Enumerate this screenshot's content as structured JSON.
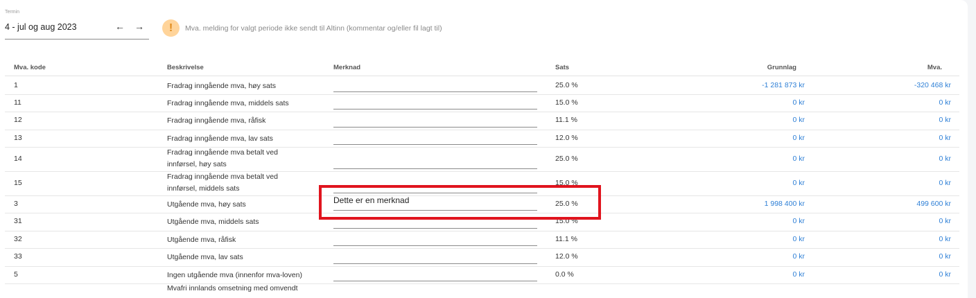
{
  "period": {
    "label": "Termin",
    "value": "4 - jul og aug 2023",
    "prev_icon": "arrow-left-icon",
    "next_icon": "arrow-right-icon"
  },
  "warning": {
    "icon": "warning-icon",
    "text": "Mva. melding for valgt periode ikke sendt til Altinn (kommentar og/eller fil lagt til)"
  },
  "table": {
    "headers": {
      "code": "Mva. kode",
      "desc": "Beskrivelse",
      "remark": "Merknad",
      "rate": "Sats",
      "base": "Grunnlag",
      "vat": "Mva."
    },
    "rows": [
      {
        "code": "1",
        "desc": [
          "Fradrag inngående mva, høy sats"
        ],
        "remark": "",
        "rate": "25.0 %",
        "base": "-1 281 873 kr",
        "vat": "-320 468 kr"
      },
      {
        "code": "11",
        "desc": [
          "Fradrag inngående mva, middels sats"
        ],
        "remark": "",
        "rate": "15.0 %",
        "base": "0 kr",
        "vat": "0 kr"
      },
      {
        "code": "12",
        "desc": [
          "Fradrag inngående mva, råfisk"
        ],
        "remark": "",
        "rate": "11.1 %",
        "base": "0 kr",
        "vat": "0 kr"
      },
      {
        "code": "13",
        "desc": [
          "Fradrag inngående mva, lav sats"
        ],
        "remark": "",
        "rate": "12.0 %",
        "base": "0 kr",
        "vat": "0 kr"
      },
      {
        "code": "14",
        "desc": [
          "Fradrag inngående mva betalt ved",
          "innførsel, høy sats"
        ],
        "remark": "",
        "rate": "25.0 %",
        "base": "0 kr",
        "vat": "0 kr"
      },
      {
        "code": "15",
        "desc": [
          "Fradrag inngående mva betalt ved",
          "innførsel, middels sats"
        ],
        "remark": "",
        "rate": "15.0 %",
        "base": "0 kr",
        "vat": "0 kr"
      },
      {
        "code": "3",
        "desc": [
          "Utgående mva, høy sats"
        ],
        "remark": "Dette er en merknad",
        "rate": "25.0 %",
        "base": "1 998 400 kr",
        "vat": "499 600 kr"
      },
      {
        "code": "31",
        "desc": [
          "Utgående mva, middels sats"
        ],
        "remark": "",
        "rate": "15.0 %",
        "base": "0 kr",
        "vat": "0 kr"
      },
      {
        "code": "32",
        "desc": [
          "Utgående mva, råfisk"
        ],
        "remark": "",
        "rate": "11.1 %",
        "base": "0 kr",
        "vat": "0 kr"
      },
      {
        "code": "33",
        "desc": [
          "Utgående mva, lav sats"
        ],
        "remark": "",
        "rate": "12.0 %",
        "base": "0 kr",
        "vat": "0 kr"
      },
      {
        "code": "5",
        "desc": [
          "Ingen utgående mva (innenfor mva-loven)"
        ],
        "remark": "",
        "rate": "0.0 %",
        "base": "0 kr",
        "vat": "0 kr"
      }
    ],
    "partial_next_row_text": "Mvafri innlands omsetning med omvendt"
  },
  "colors": {
    "link": "#2d7fd6",
    "warning_bg": "#ffd49a",
    "highlight": "#e0141e"
  }
}
